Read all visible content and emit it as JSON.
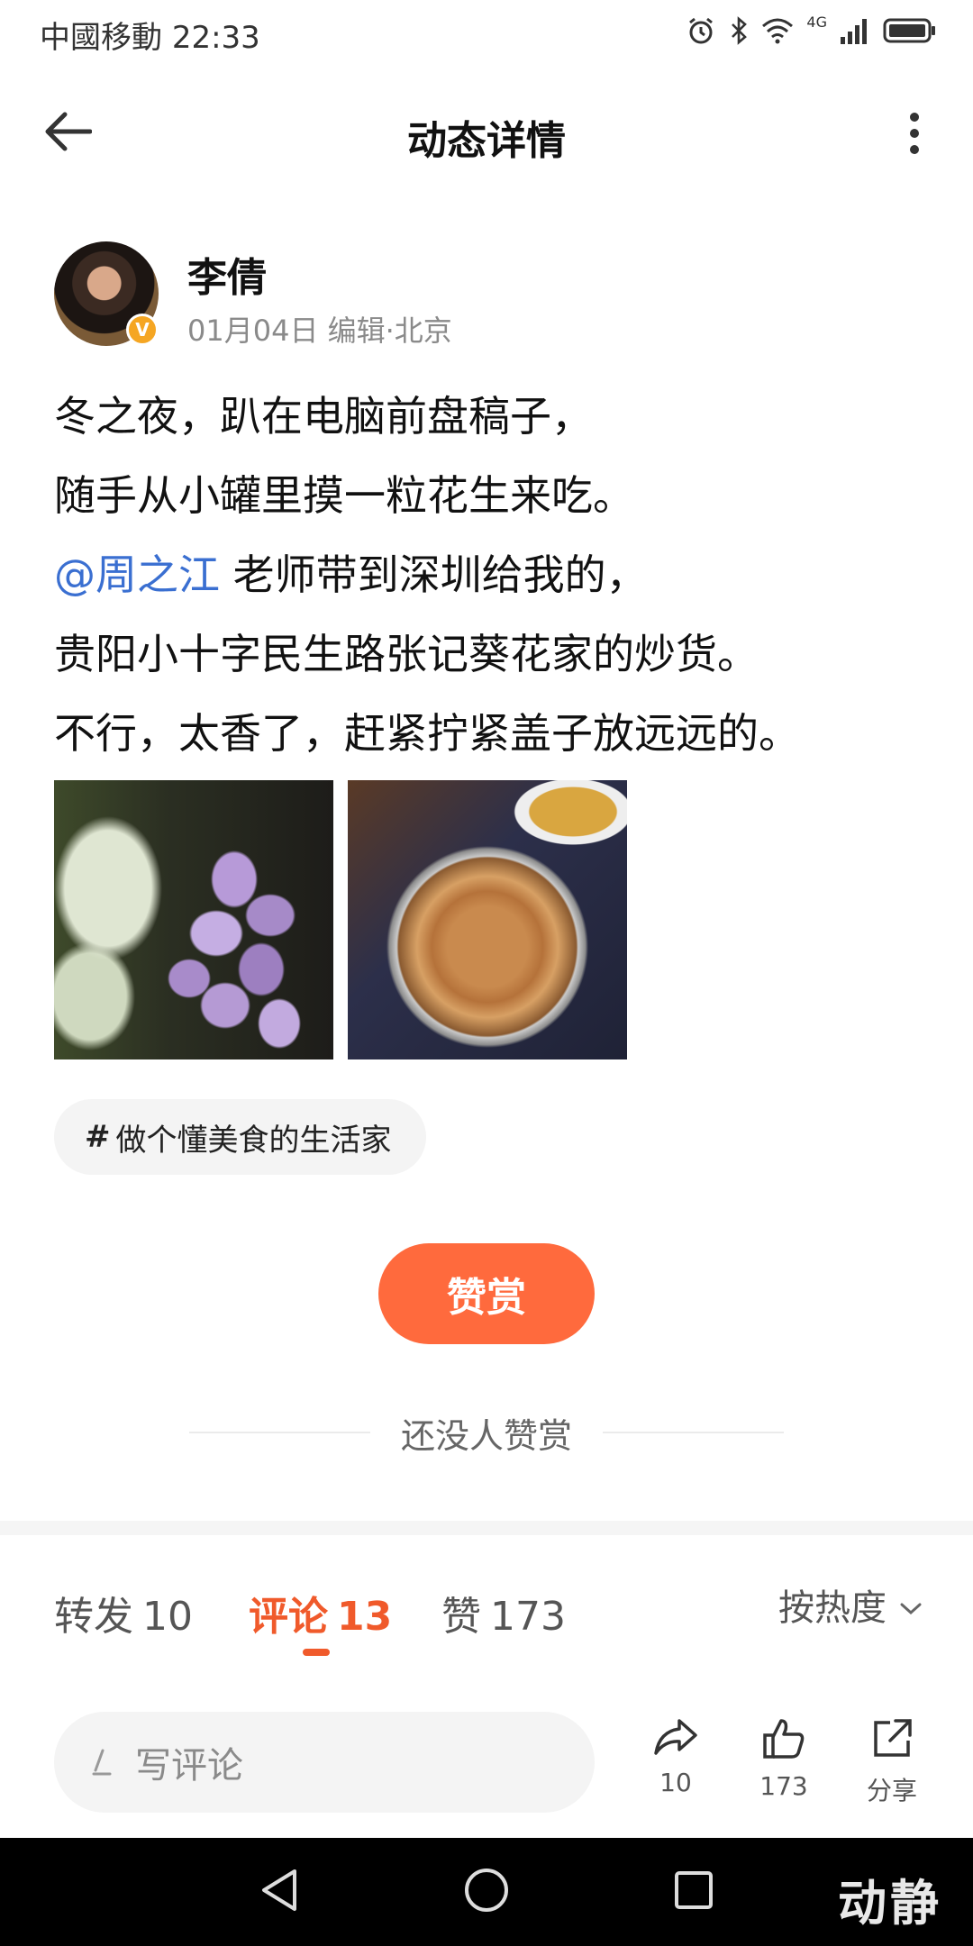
{
  "status_bar": {
    "carrier": "中國移動",
    "time": "22:33",
    "network": "4G",
    "icons": [
      "alarm-icon",
      "bluetooth-icon",
      "wifi-icon",
      "signal-icon",
      "battery-icon"
    ]
  },
  "nav": {
    "title": "动态详情",
    "back_icon": "back-arrow-icon",
    "more_icon": "more-vertical-icon"
  },
  "author": {
    "name": "李倩",
    "verified_badge": "V",
    "date": "01月04日",
    "edit_label": "编辑",
    "location": "北京",
    "meta": "01月04日 编辑·北京"
  },
  "post": {
    "lines": [
      "冬之夜，趴在电脑前盘稿子，",
      "随手从小罐里摸一粒花生来吃。",
      "老师带到深圳给我的，",
      "贵阳小十字民生路张记葵花家的炒货。",
      "不行，太香了，赶紧拧紧盖子放远远的。"
    ],
    "mention": "@周之江",
    "images": [
      "flower-photo",
      "peanuts-photo"
    ],
    "topic_hash": "#",
    "topic": "做个懂美食的生活家"
  },
  "tip": {
    "button_label": "赞赏",
    "empty_text": "还没人赞赏"
  },
  "tabs": {
    "repost_label": "转发",
    "repost_count": "10",
    "comment_label": "评论",
    "comment_count": "13",
    "like_label": "赞",
    "like_count": "173",
    "sort_label": "按热度",
    "accent_color": "#f05a2b"
  },
  "bottom_bar": {
    "comment_placeholder": "写评论",
    "share_count": "10",
    "like_count": "173",
    "external_share_label": "分享"
  },
  "watermark": "动静"
}
